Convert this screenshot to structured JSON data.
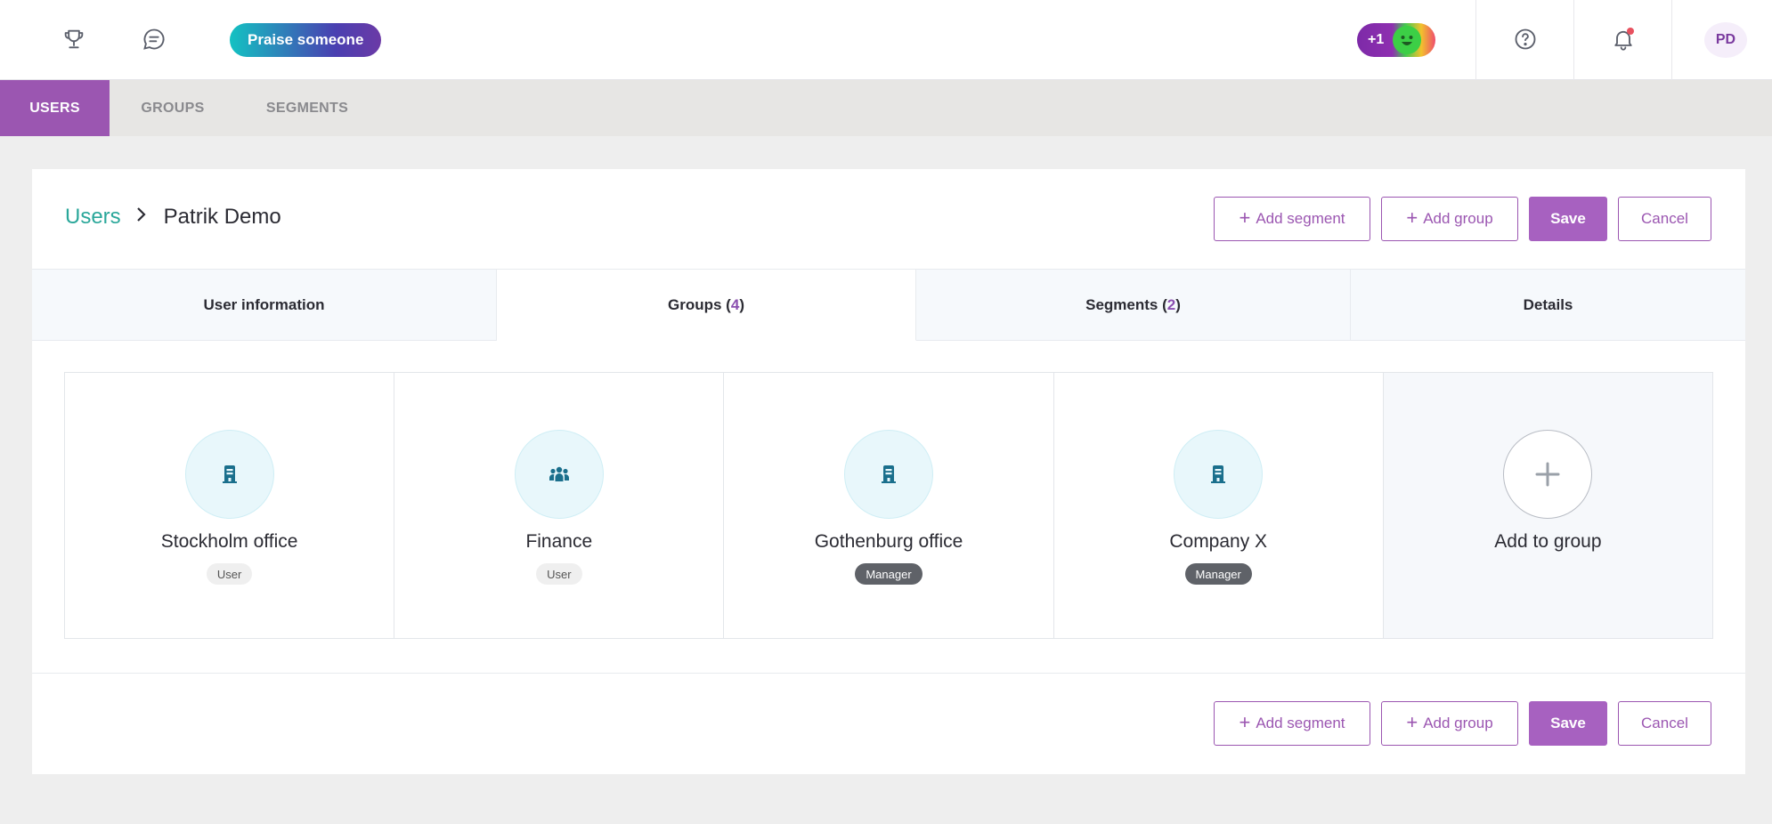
{
  "topbar": {
    "praise_label": "Praise someone",
    "points_label": "+1",
    "avatar_initials": "PD",
    "icons": [
      "trophy-icon",
      "chat-icon",
      "help-icon",
      "bell-icon"
    ]
  },
  "subnav": {
    "items": [
      {
        "label": "USERS",
        "active": true
      },
      {
        "label": "GROUPS",
        "active": false
      },
      {
        "label": "SEGMENTS",
        "active": false
      }
    ]
  },
  "breadcrumb": {
    "root": "Users",
    "current": "Patrik Demo"
  },
  "actions": {
    "add_segment": "Add segment",
    "add_group": "Add group",
    "save": "Save",
    "cancel": "Cancel"
  },
  "tabs": [
    {
      "label": "User information",
      "count": ""
    },
    {
      "label": "Groups",
      "count": "4",
      "active": true
    },
    {
      "label": "Segments",
      "count": "2"
    },
    {
      "label": "Details",
      "count": ""
    }
  ],
  "groups": [
    {
      "name": "Stockholm office",
      "role": "User",
      "icon": "building-icon"
    },
    {
      "name": "Finance",
      "role": "User",
      "icon": "team-icon"
    },
    {
      "name": "Gothenburg office",
      "role": "Manager",
      "icon": "building-icon"
    },
    {
      "name": "Company X",
      "role": "Manager",
      "icon": "building-icon"
    }
  ],
  "add_group_card": {
    "label": "Add to group"
  },
  "colors": {
    "accent": "#9b56b1",
    "link": "#2aa79a",
    "icon": "#1a6f8c"
  }
}
